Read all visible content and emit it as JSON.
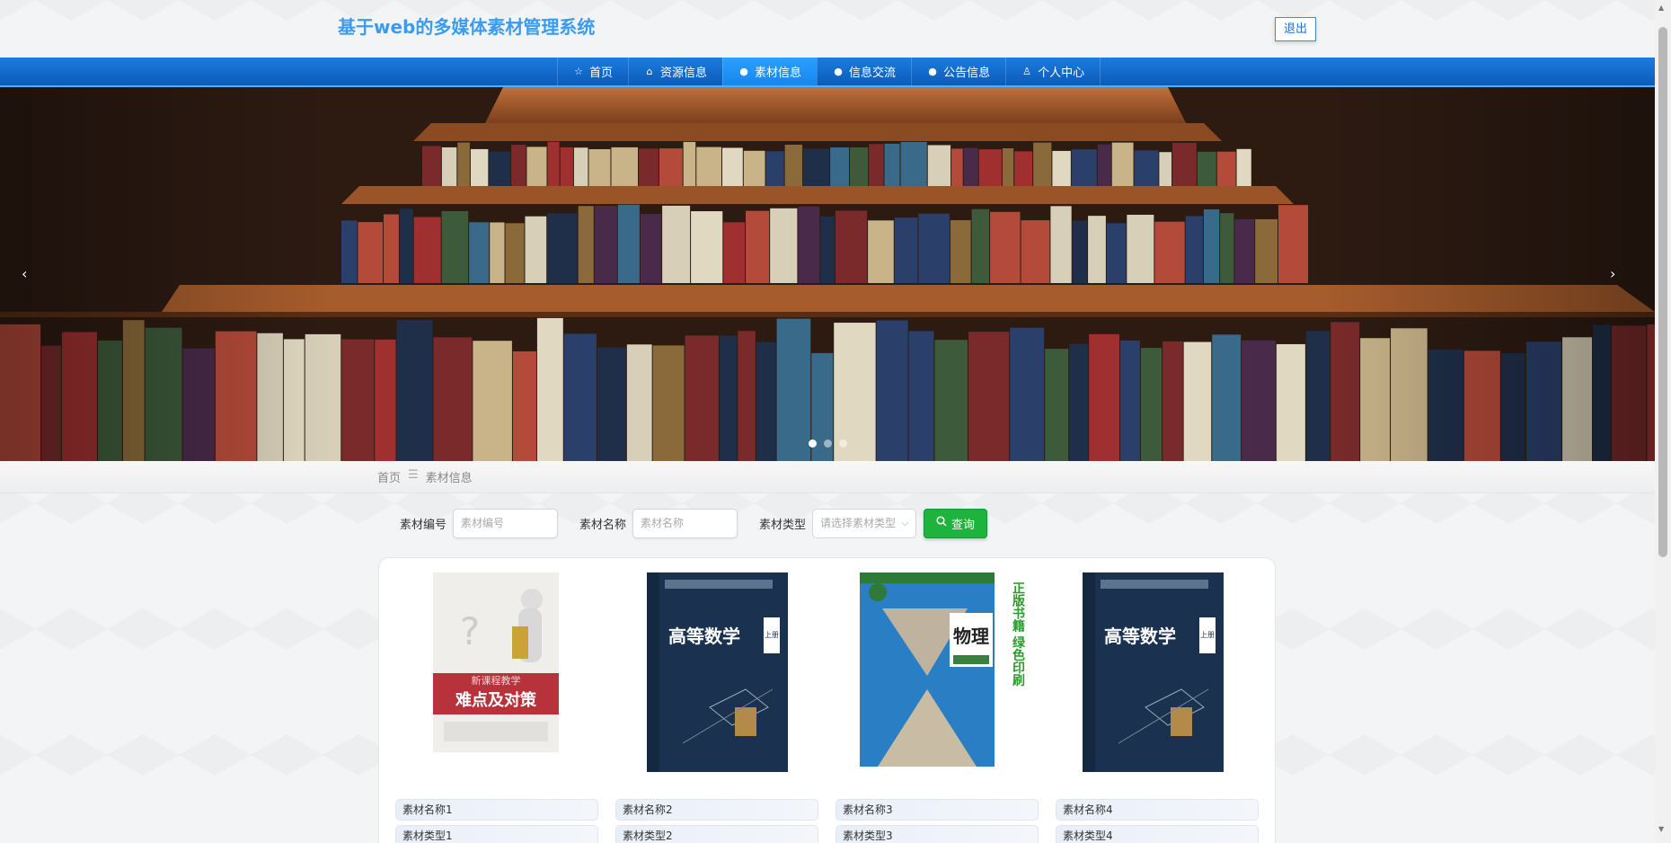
{
  "header": {
    "title": "基于web的多媒体素材管理系统",
    "logout_label": "退出"
  },
  "nav": {
    "items": [
      {
        "label": "首页",
        "icon": "star-icon",
        "glyph": "☆"
      },
      {
        "label": "资源信息",
        "icon": "bag-icon",
        "glyph": "⌂"
      },
      {
        "label": "素材信息",
        "icon": "info-icon",
        "glyph": "●"
      },
      {
        "label": "信息交流",
        "icon": "question-icon",
        "glyph": "●"
      },
      {
        "label": "公告信息",
        "icon": "info-circle-icon",
        "glyph": "●"
      },
      {
        "label": "个人中心",
        "icon": "user-icon",
        "glyph": "♙"
      }
    ],
    "active_index": 2
  },
  "banner": {
    "prev": "‹",
    "next": "›",
    "slides": 3,
    "active_slide": 0
  },
  "breadcrumb": {
    "home": "首页",
    "sep": "☰",
    "current": "素材信息"
  },
  "search": {
    "code_label": "素材编号",
    "code_placeholder": "素材编号",
    "name_label": "素材名称",
    "name_placeholder": "素材名称",
    "type_label": "素材类型",
    "type_placeholder": "请选择素材类型",
    "button_label": "查询"
  },
  "items": [
    {
      "name": "素材名称1",
      "type": "素材类型1",
      "cover": {
        "title": "难点及对策",
        "subtitle": "新课程教学"
      }
    },
    {
      "name": "素材名称2",
      "type": "素材类型2",
      "cover": {
        "title": "高等数学",
        "subtitle": "上册"
      }
    },
    {
      "name": "素材名称3",
      "type": "素材类型3",
      "cover": {
        "title": "物理",
        "side": "正版书籍 绿色印刷"
      }
    },
    {
      "name": "素材名称4",
      "type": "素材类型4",
      "cover": {
        "title": "高等数学",
        "subtitle": "上册"
      }
    }
  ],
  "colors": {
    "accent": "#3a9bf0",
    "nav": "#0b5bb8",
    "search_button": "#1eb33c"
  }
}
